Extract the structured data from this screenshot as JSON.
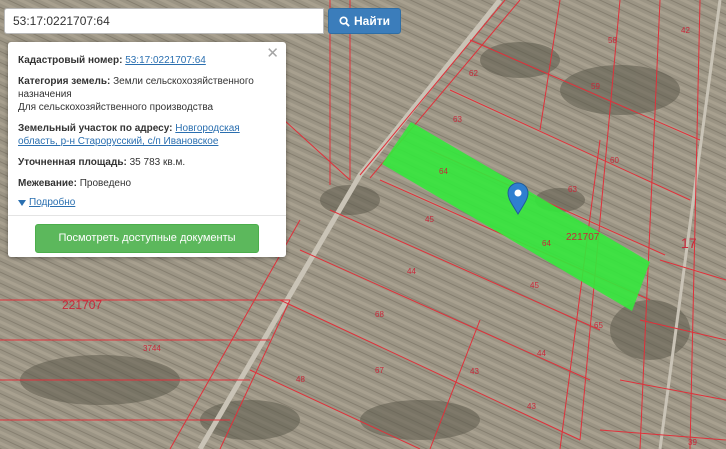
{
  "search": {
    "value": "53:17:0221707:64",
    "button_label": "Найти"
  },
  "popup": {
    "cadastral_label": "Кадастровый номер:",
    "cadastral_value": "53:17:0221707:64",
    "category_label": "Категория земель:",
    "category_value": "Земли сельскохозяйственного назначения",
    "category_use": "Для сельскохозяйственного производства",
    "address_label": "Земельный участок по адресу:",
    "address_value": "Новгородская область, р-н Старорусский, с/п Ивановское",
    "area_label": "Уточненная площадь:",
    "area_value": "35 783 кв.м.",
    "survey_label": "Межевание:",
    "survey_value": "Проведено",
    "details_link": "Подробно",
    "docs_button": "Посмотреть доступные документы",
    "close_symbol": "✕"
  },
  "map": {
    "parcel_labels": [
      "42",
      "58",
      "62",
      "59",
      "63",
      "60",
      "64",
      "63",
      "45",
      "44",
      "221707",
      "64",
      "45",
      "17",
      "68",
      "3744",
      "67",
      "44",
      "65",
      "48",
      "43",
      "43",
      "39",
      "221707"
    ],
    "colors": {
      "selected_parcel": "#34e83c",
      "boundary": "#e0303a",
      "label": "#c8283a",
      "marker": "#2f7fd0"
    }
  }
}
